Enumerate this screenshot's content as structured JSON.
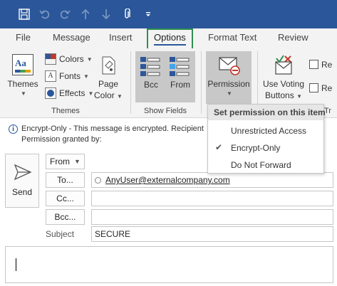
{
  "qat": {
    "save_icon": "save-icon",
    "undo_icon": "undo-icon",
    "redo_icon": "redo-icon",
    "up_icon": "up-arrow-icon",
    "down_icon": "down-arrow-icon",
    "attach_icon": "paperclip-icon",
    "customize_icon": "customize-icon"
  },
  "tabs": [
    {
      "label": "File"
    },
    {
      "label": "Message"
    },
    {
      "label": "Insert"
    },
    {
      "label": "Options",
      "active": true
    },
    {
      "label": "Format Text"
    },
    {
      "label": "Review"
    }
  ],
  "ribbon": {
    "themes": {
      "themes_label": "Themes",
      "colors_label": "Colors",
      "fonts_label": "Fonts",
      "effects_label": "Effects",
      "page_color_line1": "Page",
      "page_color_line2": "Color",
      "group_label": "Themes"
    },
    "show_fields": {
      "bcc_label": "Bcc",
      "from_label": "From",
      "group_label": "Show Fields"
    },
    "permission": {
      "label": "Permission"
    },
    "tracking": {
      "voting_line1": "Use Voting",
      "voting_line2": "Buttons",
      "check1_label": "Re",
      "check2_label": "Re",
      "group_label_fragment": "Tr"
    }
  },
  "infobar": {
    "line1": "Encrypt-Only - This message is encrypted. Recipient",
    "line2": "Permission granted by:"
  },
  "compose": {
    "send_label": "Send",
    "from_label": "From",
    "to_label": "To...",
    "cc_label": "Cc...",
    "bcc_label": "Bcc...",
    "subject_label": "Subject",
    "to_recipient": "AnyUser@externalcompany.com",
    "cc_value": "",
    "bcc_value": "",
    "subject_value": "SECURE"
  },
  "permission_menu": {
    "header": "Set permission on this item",
    "items": [
      {
        "label": "Unrestricted Access",
        "checked": false
      },
      {
        "label": "Encrypt-Only",
        "checked": true
      },
      {
        "label": "Do Not Forward",
        "checked": false
      }
    ]
  },
  "colors": {
    "titlebar": "#2b579a",
    "ribbon_bg": "#f3f3f3",
    "active_tab_outline": "#2f8f4f"
  }
}
